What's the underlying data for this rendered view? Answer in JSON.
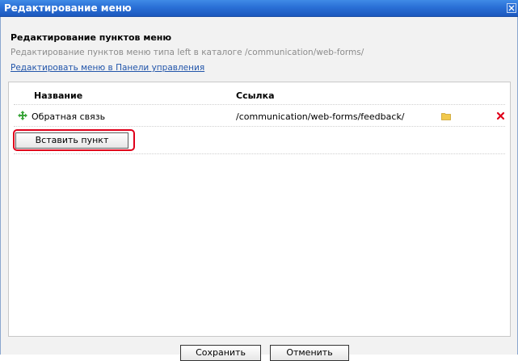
{
  "window": {
    "title": "Редактирование меню"
  },
  "header": {
    "title": "Редактирование пунктов меню",
    "description": "Редактирование пунктов меню типа left в каталоге /communication/web-forms/",
    "control_panel_link": "Редактировать меню в Панели управления"
  },
  "table": {
    "columns": [
      "Название",
      "Ссылка"
    ],
    "rows": [
      {
        "name": "Обратная связь",
        "link": "/communication/web-forms/feedback/"
      }
    ],
    "insert_button": "Вставить пункт"
  },
  "footer": {
    "save_label": "Сохранить",
    "cancel_label": "Отменить"
  },
  "colors": {
    "titlebar": "#2a6fd6",
    "highlight": "#e0001a",
    "delete": "#e0001a",
    "folder": "#f2c94c",
    "move": "#3aa53a"
  },
  "icons": [
    "close-icon",
    "move-icon",
    "folder-icon",
    "delete-icon"
  ]
}
